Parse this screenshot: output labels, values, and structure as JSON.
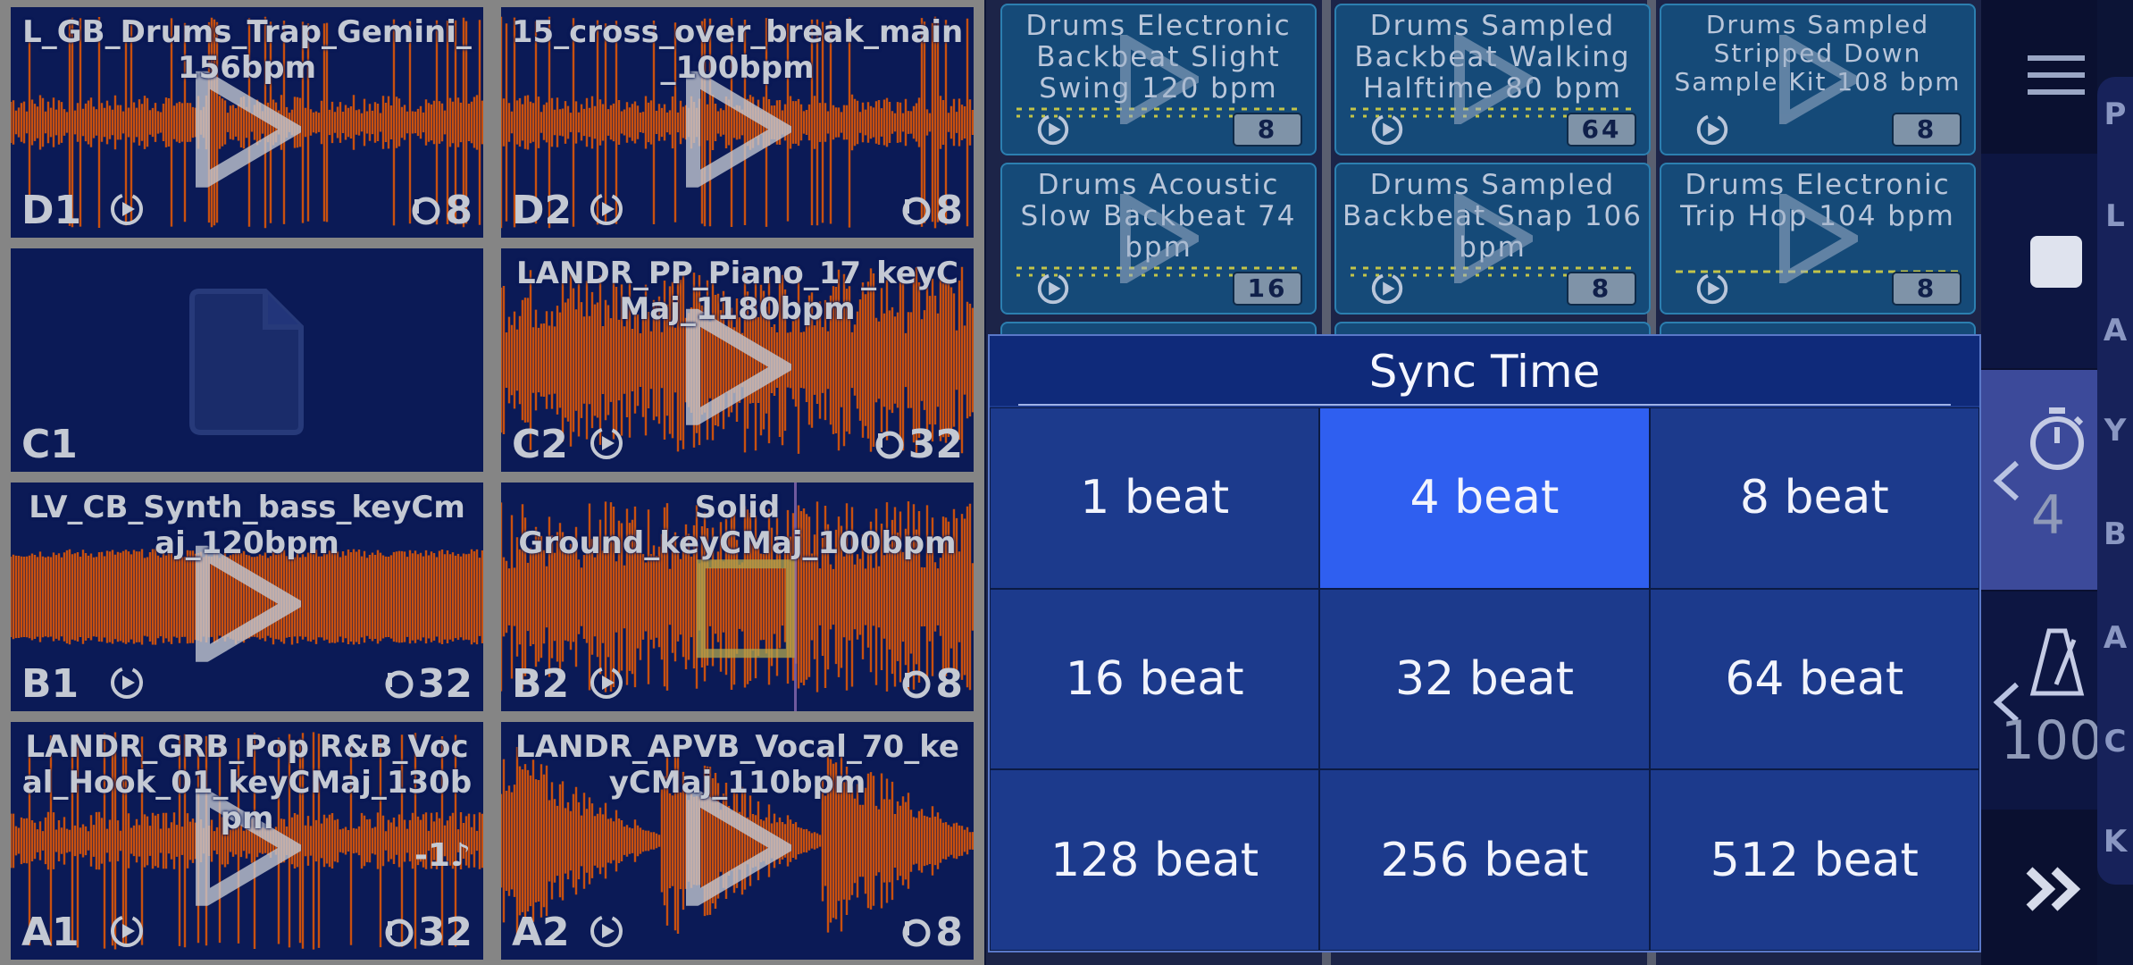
{
  "audio_pads": [
    {
      "slot": "D1",
      "title": "L_GB_Drums_Trap_Gemini_156bpm",
      "loop": "8"
    },
    {
      "slot": "D2",
      "title": "15_cross_over_break_main_100bpm",
      "loop": "8"
    },
    {
      "slot": "C1",
      "title": "",
      "loop": ""
    },
    {
      "slot": "C2",
      "title": "LANDR_PP_Piano_17_keyCMaj_1180bpm",
      "loop": "32"
    },
    {
      "slot": "B1",
      "title": "LV_CB_Synth_bass_keyCmaj_120bpm",
      "loop": "32"
    },
    {
      "slot": "B2",
      "title": "Solid Ground_keyCMaj_100bpm",
      "loop": "8"
    },
    {
      "slot": "A1",
      "title": "LANDR_GRB_Pop R&B_Vocal_Hook_01_keyCMaj_130bpm",
      "loop": "32",
      "transpose": "-1"
    },
    {
      "slot": "A2",
      "title": "LANDR_APVB_Vocal_70_keyCMaj_110bpm",
      "loop": "8"
    }
  ],
  "midi_clips": [
    {
      "title": "Drums Electronic Backbeat Slight Swing 120 bpm",
      "badge": "8"
    },
    {
      "title": "Drums Sampled Backbeat Walking Halftime 80 bpm",
      "badge": "64"
    },
    {
      "title": "Drums Sampled Stripped Down Sample Kit 108 bpm",
      "badge": "8"
    },
    {
      "title": "Drums Acoustic Slow Backbeat 74 bpm",
      "badge": "16"
    },
    {
      "title": "Drums Sampled Backbeat Snap 106 bpm",
      "badge": "8"
    },
    {
      "title": "Drums Electronic Trip Hop 104 bpm",
      "badge": "8"
    }
  ],
  "sync_popup": {
    "title": "Sync Time",
    "options": [
      "1 beat",
      "4 beat",
      "8 beat",
      "16 beat",
      "32 beat",
      "64 beat",
      "128 beat",
      "256 beat",
      "512 beat"
    ],
    "selected": "4 beat"
  },
  "sidebar": {
    "timer_value": "4",
    "tempo_value": "100"
  },
  "alphabet": [
    "P",
    "L",
    "A",
    "Y",
    "B",
    "A",
    "C",
    "K"
  ],
  "colors": {
    "waveform": "#c8500f",
    "pad_bg": "#0b1a56",
    "clip_bg": "#154a78",
    "popup_bg": "#1c3a8c",
    "popup_selected": "#2f5ff0"
  },
  "icons": {
    "menu": "menu-icon",
    "stop": "stop-icon",
    "timer": "stopwatch-icon",
    "metronome": "metronome-icon",
    "forward": "double-chevron-right-icon",
    "play": "play-icon",
    "sync": "sync-icon",
    "loop": "loop-icon",
    "document": "document-icon"
  }
}
